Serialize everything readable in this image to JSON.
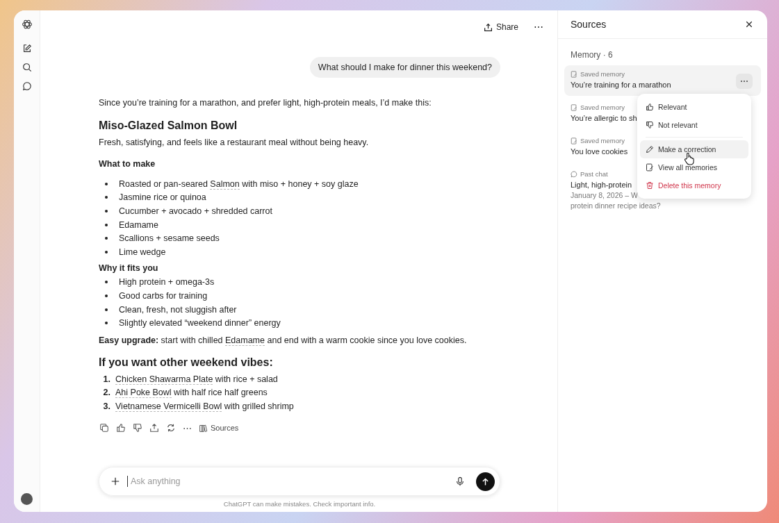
{
  "header": {
    "share": "Share",
    "more": "⋯"
  },
  "user_message": "What should I make for dinner this weekend?",
  "answer": {
    "intro": "Since you’re training for a marathon, and prefer light, high-protein meals, I’d make this:",
    "title": "Miso-Glazed Salmon Bowl",
    "tagline": "Fresh, satisfying, and feels like a restaurant meal without being heavy.",
    "sections": [
      {
        "heading": "What to make",
        "items": [
          [
            {
              "kind": "text",
              "text": "Roasted or pan-seared "
            },
            {
              "kind": "link",
              "text": "Salmon"
            },
            {
              "kind": "text",
              "text": " with miso + honey + soy glaze"
            }
          ],
          [
            {
              "kind": "text",
              "text": "Jasmine rice or quinoa"
            }
          ],
          [
            {
              "kind": "text",
              "text": "Cucumber + avocado + shredded carrot"
            }
          ],
          [
            {
              "kind": "text",
              "text": "Edamame"
            }
          ],
          [
            {
              "kind": "text",
              "text": "Scallions + sesame seeds"
            }
          ],
          [
            {
              "kind": "text",
              "text": "Lime wedge"
            }
          ]
        ]
      },
      {
        "heading": "Why it fits you",
        "items": [
          [
            {
              "kind": "text",
              "text": "High protein + omega-3s"
            }
          ],
          [
            {
              "kind": "text",
              "text": "Good carbs for training"
            }
          ],
          [
            {
              "kind": "text",
              "text": "Clean, fresh, not sluggish after"
            }
          ],
          [
            {
              "kind": "text",
              "text": "Slightly elevated “weekend dinner” energy"
            }
          ]
        ]
      }
    ],
    "upgrade": [
      {
        "kind": "bold",
        "text": "Easy upgrade:"
      },
      {
        "kind": "text",
        "text": " start with chilled "
      },
      {
        "kind": "link",
        "text": "Edamame"
      },
      {
        "kind": "text",
        "text": " and end with a warm cookie since you love cookies."
      }
    ],
    "other_heading": "If you want other weekend vibes:",
    "other": [
      {
        "number": "1.",
        "parts": [
          {
            "kind": "link",
            "text": "Chicken Shawarma Plate"
          },
          {
            "kind": "text",
            "text": " with rice + salad"
          }
        ]
      },
      {
        "number": "2.",
        "parts": [
          {
            "kind": "link",
            "text": "Ahi Poke Bowl"
          },
          {
            "kind": "text",
            "text": " with half rice half greens"
          }
        ]
      },
      {
        "number": "3.",
        "parts": [
          {
            "kind": "link",
            "text": "Vietnamese Vermicelli Bowl"
          },
          {
            "kind": "text",
            "text": " with grilled shrimp"
          }
        ]
      }
    ],
    "actions": {
      "more": "⋯",
      "sources": "Sources"
    }
  },
  "composer": {
    "placeholder": "Ask anything",
    "disclaimer": "ChatGPT can make mistakes. Check important info."
  },
  "sources": {
    "title": "Sources",
    "section": "Memory · 6",
    "items": [
      {
        "kind": "memory",
        "label": "Saved memory",
        "title": "You’re training for a marathon",
        "selected": true
      },
      {
        "kind": "memory",
        "label": "Saved memory",
        "title": "You’re allergic to sh",
        "selected": false
      },
      {
        "kind": "memory",
        "label": "Saved memory",
        "title": "You love cookies",
        "selected": false
      },
      {
        "kind": "chat",
        "label": "Past chat",
        "title": "Light, high-protein",
        "snippet": [
          "January 8, 2026 – W",
          "protein dinner recipe ideas?"
        ],
        "selected": false
      }
    ],
    "menu": [
      {
        "kind": "like",
        "label": "Relevant",
        "selected": false,
        "danger": false
      },
      {
        "kind": "dislike",
        "label": "Not relevant",
        "selected": false,
        "danger": false
      },
      {
        "kind": "separator"
      },
      {
        "kind": "edit",
        "label": "Make a correction",
        "selected": true,
        "danger": false
      },
      {
        "kind": "memory",
        "label": "View all memories",
        "selected": false,
        "danger": false
      },
      {
        "kind": "delete",
        "label": "Delete this memory",
        "selected": false,
        "danger": true
      }
    ]
  }
}
